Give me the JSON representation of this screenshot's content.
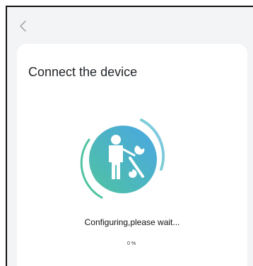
{
  "header": {
    "back_icon": "chevron-left-icon"
  },
  "card": {
    "title": "Connect the device",
    "illustration_icon": "technician-with-wrench-icon",
    "status_text": "Configuring,please wait...",
    "progress_text": "0%",
    "colors": {
      "gradient_start": "#4fc3a1",
      "gradient_end": "#4aa6e4"
    }
  }
}
